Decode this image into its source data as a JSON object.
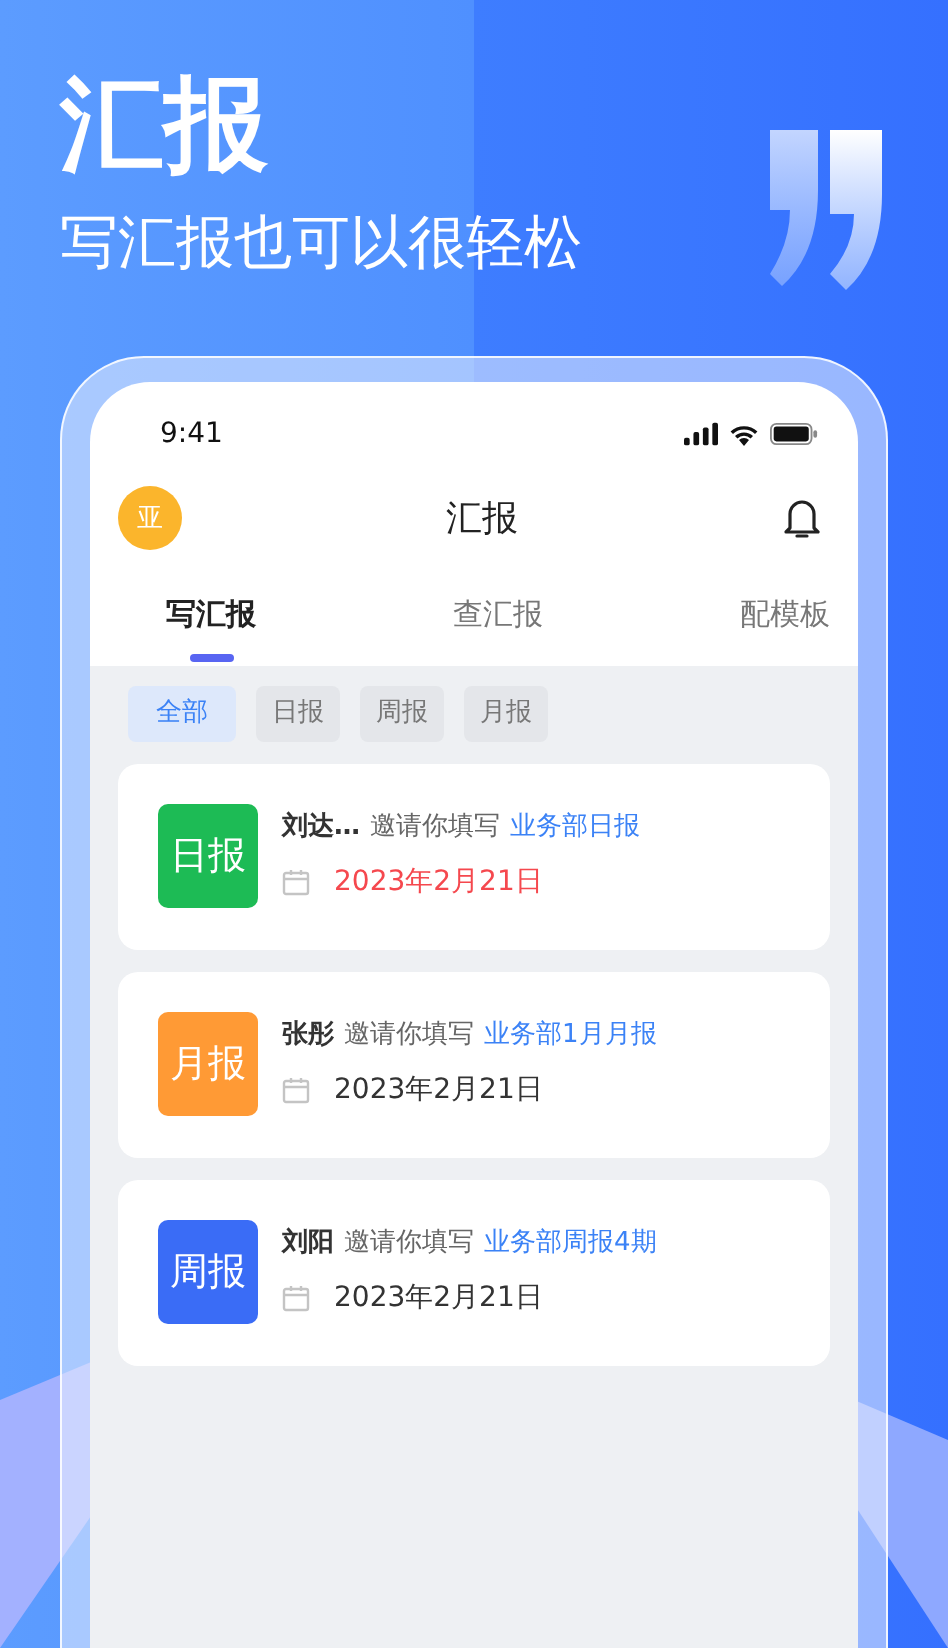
{
  "promo": {
    "headline": "汇报",
    "subtitle": "写汇报也可以很轻松"
  },
  "status_bar": {
    "time": "9:41"
  },
  "header": {
    "avatar": "亚",
    "title": "汇报"
  },
  "tabs": [
    {
      "label": "写汇报",
      "selected": true
    },
    {
      "label": "查汇报",
      "selected": false
    },
    {
      "label": "配模板",
      "selected": false
    }
  ],
  "filters": [
    {
      "label": "全部",
      "selected": true
    },
    {
      "label": "日报",
      "selected": false
    },
    {
      "label": "周报",
      "selected": false
    },
    {
      "label": "月报",
      "selected": false
    }
  ],
  "reports": [
    {
      "badge": "日报",
      "color": "#1dbb55",
      "sender": "刘达…",
      "action": "邀请你填写",
      "report_name": "业务部日报",
      "date": "2023年2月21日",
      "overdue": true
    },
    {
      "badge": "月报",
      "color": "#ff9a35",
      "sender": "张彤",
      "action": "邀请你填写",
      "report_name": "业务部1月月报",
      "date": "2023年2月21日",
      "overdue": false
    },
    {
      "badge": "周报",
      "color": "#3a6cf6",
      "sender": "刘阳",
      "action": "邀请你填写",
      "report_name": "业务部周报4期",
      "date": "2023年2月21日",
      "overdue": false
    }
  ]
}
